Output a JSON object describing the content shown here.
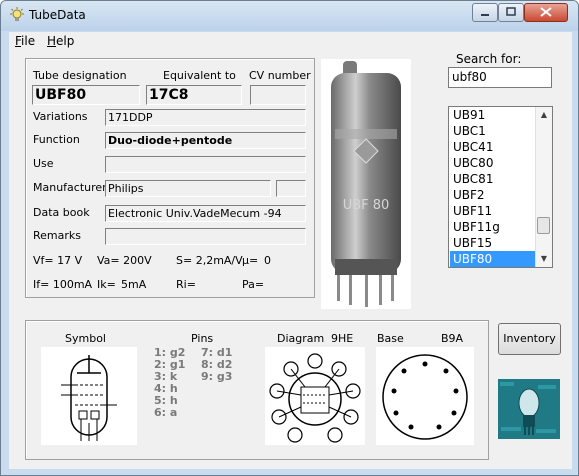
{
  "window": {
    "title": "TubeData"
  },
  "menu": {
    "file": "File",
    "help": "Help"
  },
  "tube": {
    "designation_label": "Tube designation",
    "designation": "UBF80",
    "equivalent_label": "Equivalent to",
    "equivalent": "17C8",
    "cv_label": "CV number",
    "cv": "",
    "variations_label": "Variations",
    "variations": "171DDP",
    "function_label": "Function",
    "function": "Duo-diode+pentode",
    "use_label": "Use",
    "use": "",
    "manufacturer_label": "Manufacturer",
    "manufacturer": "Philips",
    "manufacturer_extra": "",
    "databook_label": "Data book",
    "databook": "Electronic Univ.VadeMecum -94",
    "remarks_label": "Remarks",
    "remarks": ""
  },
  "specs": {
    "vf": "Vf= 17 V",
    "va": "Va= 200V",
    "s": "S= 2,2mA/V",
    "mu": "µ=",
    "mu_val": "0",
    "if": "If= 100mA",
    "ik": "Ik=",
    "ik_val": "5mA",
    "ri": "Ri=",
    "pa": "Pa="
  },
  "search": {
    "label": "Search for:",
    "value": "ubf80"
  },
  "list": {
    "items": [
      "UB91",
      "UBC1",
      "UBC41",
      "UBC80",
      "UBC81",
      "UBF2",
      "UBF11",
      "UBF11g",
      "UBF15",
      "UBF80"
    ],
    "selected": "UBF80"
  },
  "bottom": {
    "symbol_label": "Symbol",
    "pins_label": "Pins",
    "diagram_label": "Diagram",
    "diagram_code": "9HE",
    "base_label": "Base",
    "base_code": "B9A",
    "pins_left": [
      "1: g2",
      "2: g1",
      "3: k",
      "4: h",
      "5: h",
      "6: a"
    ],
    "pins_right": [
      "7: d1",
      "8: d2",
      "9: g3"
    ]
  },
  "buttons": {
    "inventory": "Inventory"
  },
  "photo": {
    "text": "UBF 80"
  },
  "colors": {
    "selection": "#3399ff",
    "window_frame": "#c9dcef",
    "client": "#f0f0f0",
    "logo": "#1f7a86"
  }
}
